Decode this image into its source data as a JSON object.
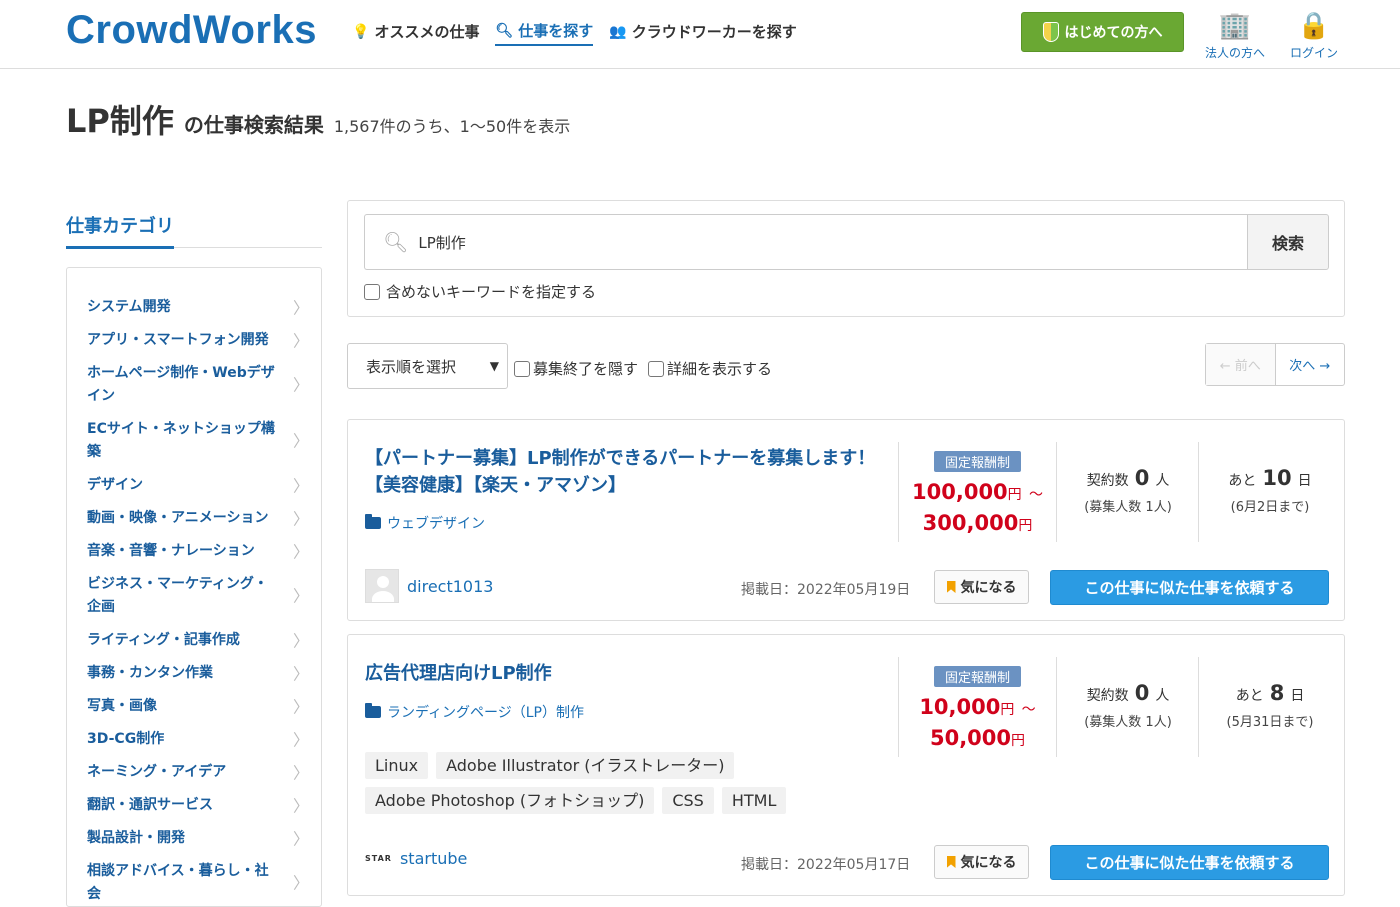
{
  "header": {
    "logo": "CrowdWorks",
    "nav": [
      {
        "icon": "lightbulb-icon",
        "label": "オススメの仕事"
      },
      {
        "icon": "search-icon",
        "label": "仕事を探す"
      },
      {
        "icon": "people-icon",
        "label": "クラウドワーカーを探す"
      }
    ],
    "first_button": "はじめての方へ",
    "corporate_label": "法人の方へ",
    "login_label": "ログイン"
  },
  "page": {
    "keyword": "LP制作",
    "title_suffix": "の仕事検索結果",
    "result_count": "1,567件のうち、1〜50件を表示"
  },
  "sidebar": {
    "heading": "仕事カテゴリ",
    "items": [
      "システム開発",
      "アプリ・スマートフォン開発",
      "ホームページ制作・Webデザイン",
      "ECサイト・ネットショップ構築",
      "デザイン",
      "動画・映像・アニメーション",
      "音楽・音響・ナレーション",
      "ビジネス・マーケティング・企画",
      "ライティング・記事作成",
      "事務・カンタン作業",
      "写真・画像",
      "3D-CG制作",
      "ネーミング・アイデア",
      "翻訳・通訳サービス",
      "製品設計・開発",
      "相談アドバイス・暮らし・社会"
    ]
  },
  "search": {
    "value": "LP制作",
    "button": "検索",
    "exclude_label": "含めないキーワードを指定する"
  },
  "controls": {
    "sort_label": "表示順を選択",
    "hide_closed": "募集終了を隠す",
    "show_details": "詳細を表示する",
    "prev": "← 前へ",
    "next": "次へ →"
  },
  "jobs": [
    {
      "title": "【パートナー募集】LP制作ができるパートナーを募集します！【美容健康】【楽天・アマゾン】",
      "category": "ウェブデザイン",
      "badge": "固定報酬制",
      "price_min": "100,000",
      "price_max": "300,000",
      "yen": "円",
      "tilde": "〜",
      "contracts_label": "契約数",
      "contracts": "0",
      "person_unit": "人",
      "recruit": "(募集人数 1人)",
      "remain_label": "あと",
      "remain_days": "10",
      "day_unit": "日",
      "deadline": "(6月2日まで)",
      "client": "direct1013",
      "posted": "掲載日：2022年05月19日",
      "fav": "気になる",
      "request": "この仕事に似た仕事を依頼する"
    },
    {
      "title": "広告代理店向けLP制作",
      "category": "ランディングページ（LP）制作",
      "badge": "固定報酬制",
      "price_min": "10,000",
      "price_max": "50,000",
      "yen": "円",
      "tilde": "〜",
      "contracts_label": "契約数",
      "contracts": "0",
      "person_unit": "人",
      "recruit": "(募集人数 1人)",
      "remain_label": "あと",
      "remain_days": "8",
      "day_unit": "日",
      "deadline": "(5月31日まで)",
      "skills": [
        "Linux",
        "Adobe Illustrator (イラストレーター)",
        "Adobe Photoshop (フォトショップ)",
        "CSS",
        "HTML"
      ],
      "client_logo": "STAR",
      "client": "startube",
      "posted": "掲載日：2022年05月17日",
      "fav": "気になる",
      "request": "この仕事に似た仕事を依頼する"
    }
  ],
  "colors": {
    "brand": "#1a6fb5",
    "price": "#d0021b",
    "green_button": "#6aa833",
    "request_button": "#2b9be3",
    "badge": "#6b92c2"
  }
}
